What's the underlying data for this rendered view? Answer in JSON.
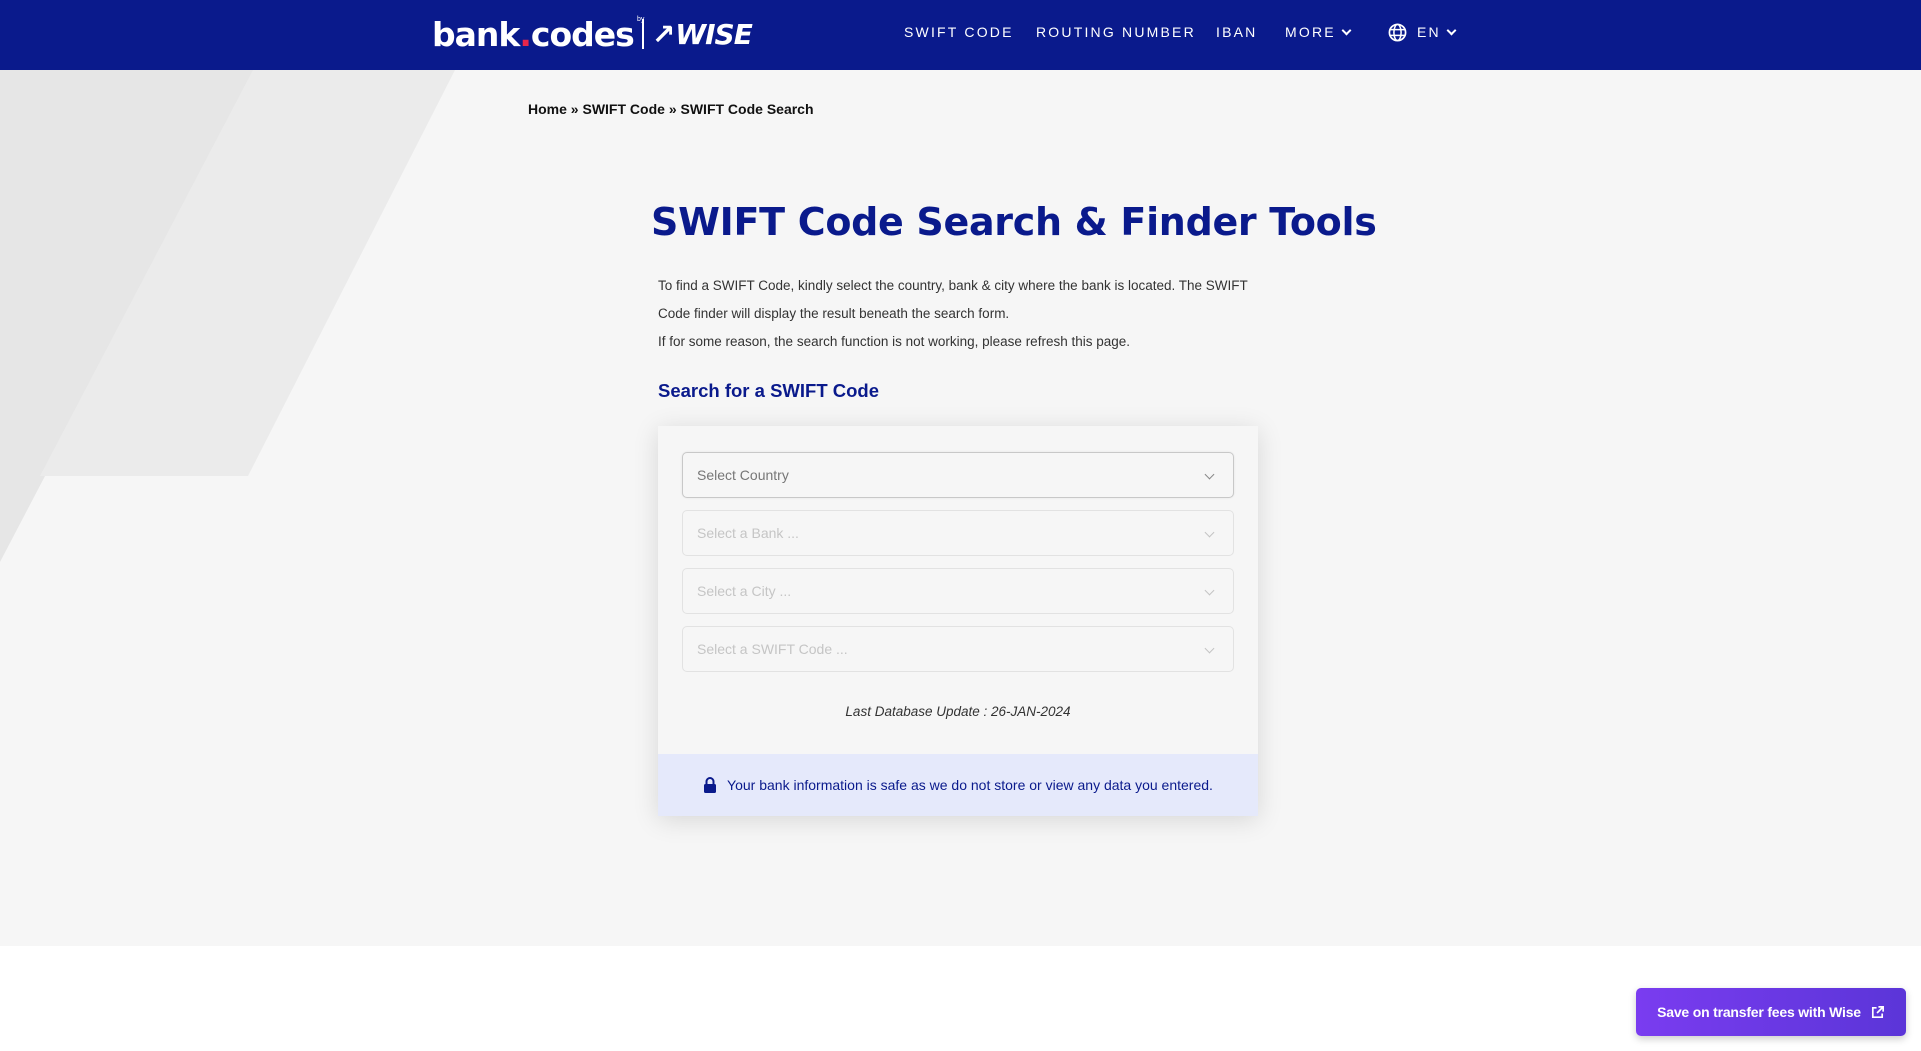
{
  "header": {
    "logo": {
      "main": "bank",
      "dot": ".",
      "suffix": "codes",
      "by": "by",
      "brand": "WISE"
    },
    "nav": [
      {
        "label": "SWIFT CODE"
      },
      {
        "label": "ROUTING NUMBER"
      },
      {
        "label": "IBAN"
      },
      {
        "label": "MORE"
      }
    ],
    "language": {
      "label": "EN",
      "icon": "globe-icon"
    }
  },
  "breadcrumb": {
    "items": [
      "Home",
      "SWIFT Code",
      "SWIFT Code Search"
    ],
    "separator": "»"
  },
  "main": {
    "title": "SWIFT Code Search & Finder Tools",
    "description_1": "To find a SWIFT Code, kindly select the country, bank & city where the bank is located. The SWIFT Code finder will display the result beneath the search form.",
    "description_2": "If for some reason, the search function is not working, please refresh this page.",
    "subtitle": "Search for a SWIFT Code"
  },
  "search_form": {
    "country_placeholder": "Select Country",
    "bank_placeholder": "Select a Bank ...",
    "city_placeholder": "Select a City ...",
    "swift_placeholder": "Select a SWIFT Code ...",
    "last_update": "Last Database Update : 26-JAN-2024",
    "safe_notice": "Your bank information is safe as we do not store or view any data you entered."
  },
  "cta": {
    "label": "Save on transfer fees with Wise",
    "icon": "external-link-icon"
  },
  "colors": {
    "brand_navy": "#0a1a8c",
    "accent_pink": "#e8264b",
    "cta_purple": "#7a3cf0",
    "notice_bg": "#e5e9fb"
  }
}
